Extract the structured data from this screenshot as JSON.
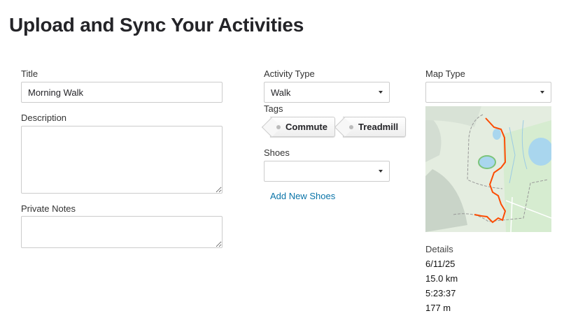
{
  "page": {
    "title": "Upload and Sync Your Activities"
  },
  "form": {
    "title_label": "Title",
    "title_value": "Morning Walk",
    "description_label": "Description",
    "description_value": "",
    "private_notes_label": "Private Notes",
    "private_notes_value": "",
    "activity_type_label": "Activity Type",
    "activity_type_value": "Walk",
    "tags_label": "Tags",
    "tags": [
      "Commute",
      "Treadmill"
    ],
    "shoes_label": "Shoes",
    "shoes_value": "",
    "add_shoes_link": "Add New Shoes",
    "map_type_label": "Map Type",
    "map_type_value": ""
  },
  "details": {
    "label": "Details",
    "date": "6/11/25",
    "distance": "15.0 km",
    "duration": "5:23:37",
    "elevation": "177 m"
  },
  "colors": {
    "route": "#fc4c02",
    "link": "#0a74a8",
    "map_bg": "#e4ede0",
    "water": "#a9d6ee"
  }
}
